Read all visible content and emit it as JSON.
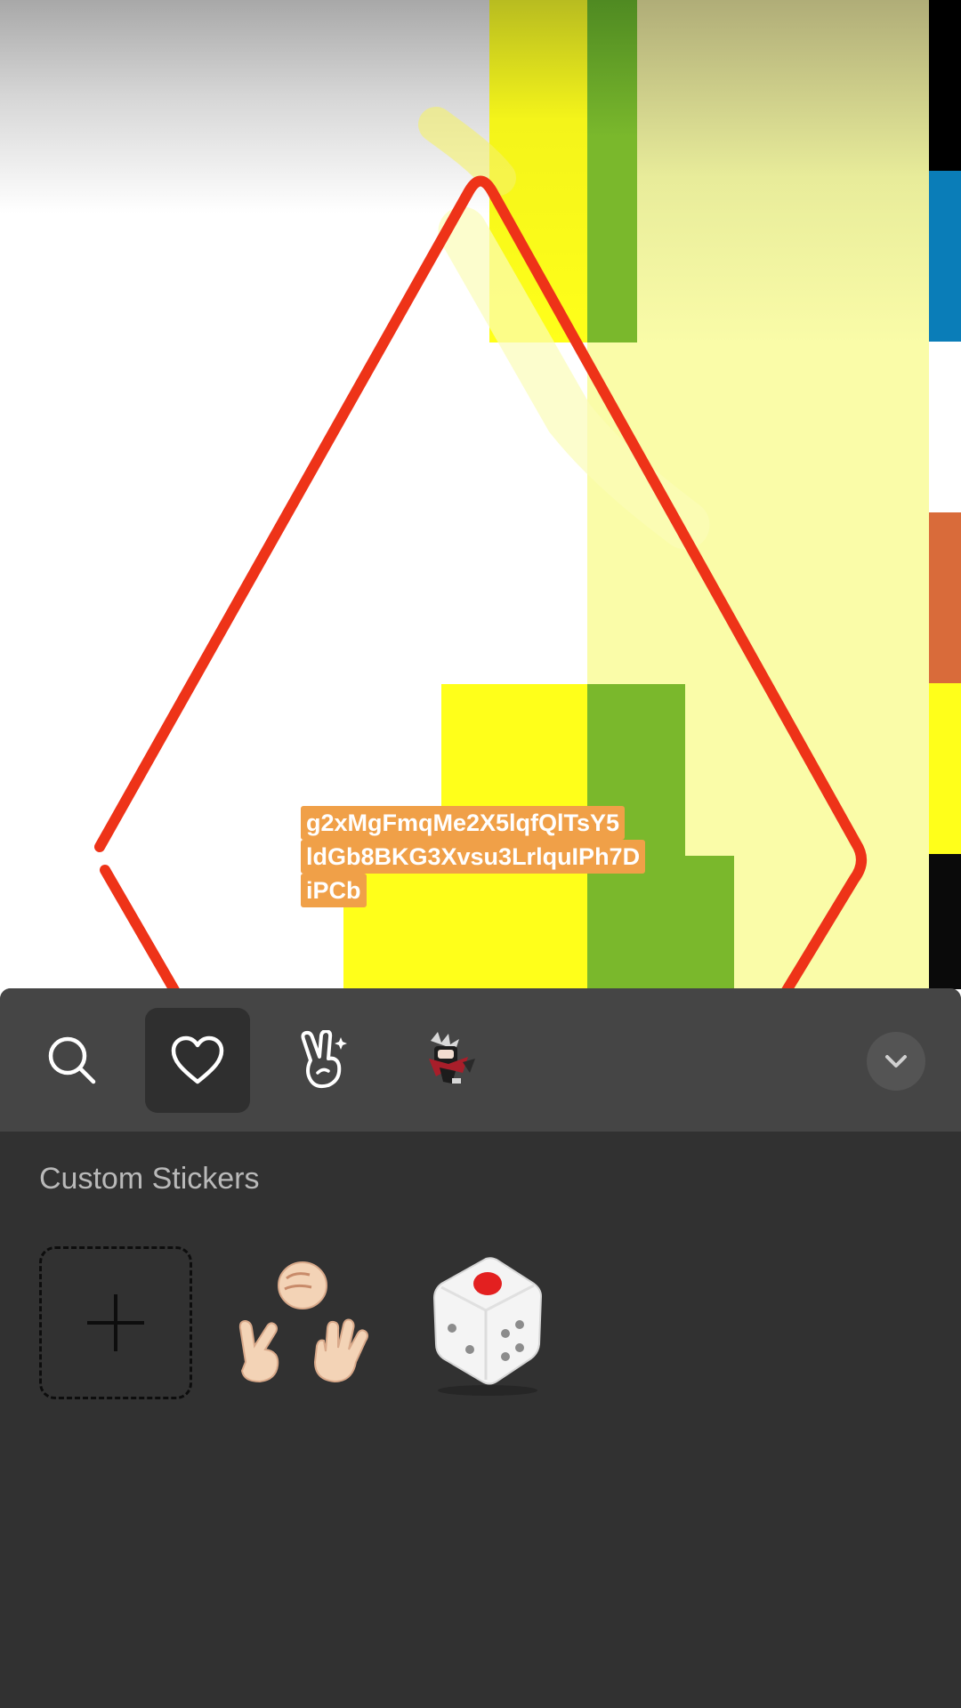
{
  "canvas": {
    "caption_lines": [
      "g2xMgFmqMe2X5lqfQlTsY5",
      "ldGb8BKG3Xvsu3LrlquIPh7D",
      "iPCb"
    ],
    "colors": {
      "outline": "#ee3318",
      "caption_bg": "#f0a048",
      "yellow": "#ffff1a",
      "pale_yellow": "#fafca8",
      "green": "#7ab82c",
      "blue": "#0a7db8",
      "orange": "#d96b3a"
    }
  },
  "toolbar": {
    "tabs": [
      {
        "icon": "search-icon"
      },
      {
        "icon": "heart-icon",
        "active": true
      },
      {
        "icon": "peace-hand-icon"
      },
      {
        "icon": "character-sticker-icon"
      }
    ],
    "collapse_icon": "chevron-down-icon"
  },
  "stickers": {
    "section_title": "Custom Stickers",
    "items": [
      {
        "icon": "plus-icon"
      },
      {
        "icon": "rock-paper-scissors-icon"
      },
      {
        "icon": "dice-icon"
      }
    ]
  }
}
